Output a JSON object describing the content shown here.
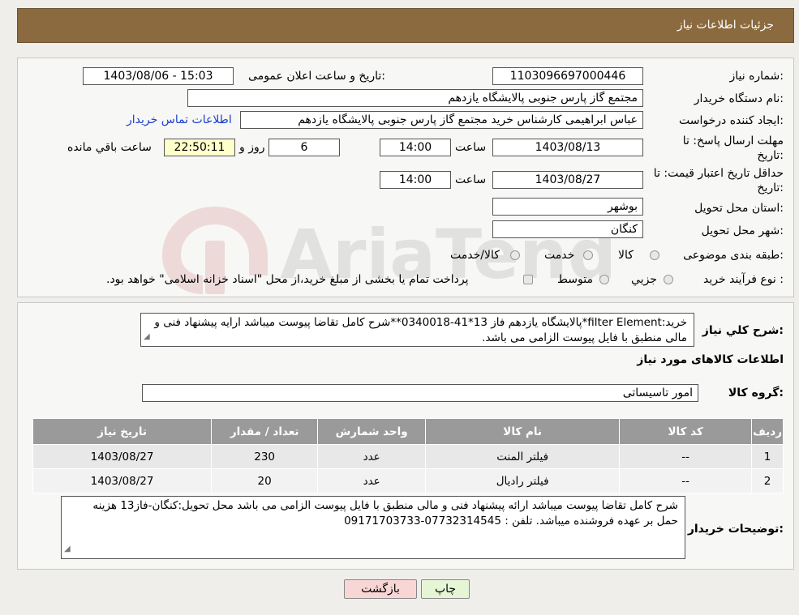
{
  "header": {
    "title": "جزئیات اطلاعات نیاز"
  },
  "form": {
    "need_number_label": "شماره نیاز:",
    "need_number": "1103096697000446",
    "announce_label": "تاریخ و ساعت اعلان عمومی:",
    "announce_value": "1403/08/06 - 15:03",
    "buyer_org_label": "نام دستگاه خریدار:",
    "buyer_org": "مجتمع گاز پارس جنوبی  پالایشگاه یازدهم",
    "requester_label": "ایجاد کننده درخواست:",
    "requester": "عباس ابراهیمی کارشناس خرید مجتمع گاز پارس جنوبی  پالایشگاه یازدهم",
    "contact_link": "اطلاعات تماس خریدار",
    "deadline_label_1": "مهلت ارسال پاسخ: تا",
    "deadline_label_2": "تاریخ:",
    "deadline_date": "1403/08/13",
    "time_label": "ساعت",
    "deadline_time": "14:00",
    "days_value": "6",
    "days_label": "روز و",
    "remaining_time": "22:50:11",
    "remaining_label": "ساعت باقي مانده",
    "validity_label_1": "حداقل تاریخ اعتبار قیمت: تا",
    "validity_label_2": "تاریخ:",
    "validity_date": "1403/08/27",
    "validity_time": "14:00",
    "province_label": "استان محل تحویل:",
    "province": "بوشهر",
    "city_label": "شهر محل تحویل:",
    "city": "کنگان",
    "category_label": "طبقه بندی موضوعی:",
    "category_options": [
      "کالا",
      "خدمت",
      "کالا/خدمت"
    ],
    "purchase_type_label": "نوع فرآیند خرید :",
    "purchase_options": [
      "جزيي",
      "متوسط"
    ],
    "purchase_note": "پرداخت تمام یا بخشی از مبلغ خرید،از محل \"اسناد خزانه اسلامی\" خواهد بود."
  },
  "summary": {
    "label": "شرح کلي نياز:",
    "text": "خرید:filter Element*پالایشگاه یازدهم فاز 13*41-0340018**شرح کامل تقاضا پیوست میباشد ارایه پیشنهاد فنی و مالی منطبق با فایل پیوست الزامی می باشد."
  },
  "goods": {
    "section_title": "اطلاعات کالاهای مورد نیاز",
    "group_label": "گروه کالا:",
    "group_value": "امور تاسیساتی",
    "columns": [
      "ردیف",
      "کد کالا",
      "نام کالا",
      "واحد شمارش",
      "تعداد / مقدار",
      "تاریخ نیاز"
    ],
    "rows": [
      [
        "1",
        "--",
        "فیلتر المنت",
        "عدد",
        "230",
        "1403/08/27"
      ],
      [
        "2",
        "--",
        "فیلتر رادیال",
        "عدد",
        "20",
        "1403/08/27"
      ]
    ]
  },
  "notes": {
    "label": "توضیحات خریدار:",
    "text": "شرح کامل تقاضا پیوست میباشد ارائه پیشنهاد فنی و مالی منطبق با فایل پیوست الزامی می باشد محل تحویل:کنگان-فاز13 هزینه حمل بر عهده فروشنده میباشد. تلفن : 07732314545-09171703733"
  },
  "buttons": {
    "print": "چاپ",
    "back": "بازگشت"
  },
  "watermark": {
    "text": "AriaTender.neT"
  },
  "colors": {
    "header": "#8a6a3e",
    "back_button": "#f9d6d6",
    "print_button": "#e6f5d6"
  }
}
